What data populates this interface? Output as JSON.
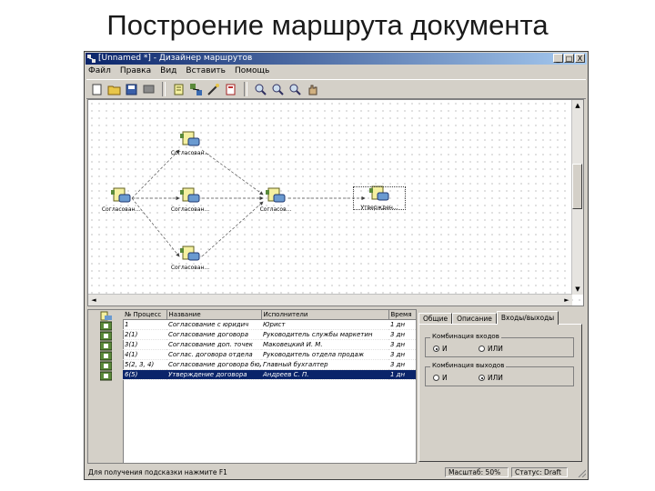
{
  "slide": {
    "title": "Построение маршрута документа"
  },
  "window": {
    "title": "[Unnamed *] - Дизайнер маршрутов",
    "controls": {
      "minimize": "_",
      "maximize": "□",
      "close": "X"
    }
  },
  "menu": {
    "items": [
      "Файл",
      "Правка",
      "Вид",
      "Вставить",
      "Помощь"
    ]
  },
  "toolbar": {
    "buttons": [
      "new-icon",
      "open-folder-icon",
      "save-icon",
      "flag-icon",
      "document-icon",
      "route-icon",
      "wand-icon",
      "properties-icon",
      "zoom-in-icon",
      "zoom-out-icon",
      "zoom-fit-icon",
      "hand-icon"
    ]
  },
  "diagram": {
    "nodes": [
      {
        "id": "n1",
        "label": "Согласован..."
      },
      {
        "id": "n2",
        "label": "Согласован..."
      },
      {
        "id": "n3",
        "label": "Согласован..."
      },
      {
        "id": "n4",
        "label": "Согласован..."
      },
      {
        "id": "n5",
        "label": "Согласов..."
      },
      {
        "id": "n6",
        "label": "Утвержден..."
      }
    ]
  },
  "table": {
    "columns": [
      "№ Процесс",
      "Название",
      "Исполнители",
      "Время"
    ],
    "rows": [
      {
        "num": "1",
        "name": "Согласование с юридич",
        "performer": "Юрист",
        "time": "1 дн"
      },
      {
        "num": "2(1)",
        "name": "Согласование договора",
        "performer": "Руководитель службы маркетин",
        "time": "3 дн"
      },
      {
        "num": "3(1)",
        "name": "Согласование доп. точек",
        "performer": "Маковецкий И. М.",
        "time": "3 дн"
      },
      {
        "num": "4(1)",
        "name": "Соглас. договора отдела",
        "performer": "Руководитель отдела продаж",
        "time": "3 дн"
      },
      {
        "num": "5(2, 3, 4)",
        "name": "Согласование договора бюджет",
        "performer": "Главный бухгалтер",
        "time": "3 дн"
      },
      {
        "num": "6(5)",
        "name": "Утверждение договора",
        "performer": "Андреев С. П.",
        "time": "1 дн"
      }
    ],
    "selected_index": 5
  },
  "properties": {
    "tabs": [
      "Общие",
      "Описание",
      "Входы/выходы"
    ],
    "active_tab": 2,
    "inputs_group": {
      "title": "Комбинация входов",
      "option_and": "И",
      "option_or": "ИЛИ",
      "selected": "and"
    },
    "outputs_group": {
      "title": "Комбинация выходов",
      "option_and": "И",
      "option_or": "ИЛИ",
      "selected": "or"
    }
  },
  "status": {
    "hint": "Для получения подсказки нажмите F1",
    "scale": "Масштаб: 50%",
    "state": "Статус: Draft"
  },
  "colors": {
    "titlebar": "#0a246a",
    "selection": "#0a246a",
    "face": "#d4d0c8"
  }
}
